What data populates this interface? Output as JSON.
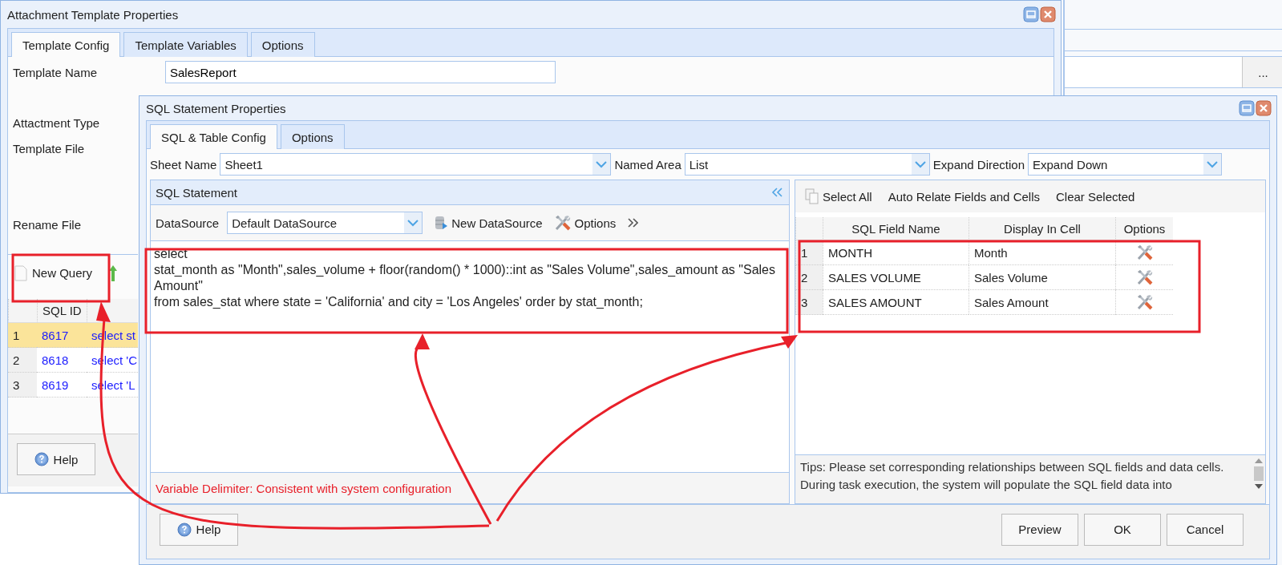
{
  "back_window": {
    "title": "Attachment Template Properties",
    "tabs": [
      {
        "label": "Template Config",
        "selected": true
      },
      {
        "label": "Template Variables",
        "selected": false
      },
      {
        "label": "Options",
        "selected": false
      }
    ],
    "template_name": {
      "label": "Template Name",
      "value": "SalesReport"
    },
    "labels": [
      "Attactment Type",
      "Template File",
      "Rename File"
    ],
    "new_query": "New Query",
    "table": {
      "columns": [
        "SQL ID"
      ],
      "rows": [
        {
          "index": "1",
          "sql_id": "8617",
          "sql": "select st",
          "selected": true
        },
        {
          "index": "2",
          "sql_id": "8618",
          "sql": "select 'C",
          "selected": false
        },
        {
          "index": "3",
          "sql_id": "8619",
          "sql": "select 'L",
          "selected": false
        }
      ]
    },
    "help": "Help"
  },
  "side_window": {
    "button": "..."
  },
  "sql_dialog": {
    "title": "SQL Statement Properties",
    "tabs": [
      {
        "label": "SQL & Table Config",
        "selected": true
      },
      {
        "label": "Options",
        "selected": false
      }
    ],
    "selects": [
      {
        "label": "Sheet Name",
        "value": "Sheet1"
      },
      {
        "label": "Named Area",
        "value": "List"
      },
      {
        "label": "Expand Direction",
        "value": "Expand Down"
      }
    ],
    "sql_panel": {
      "title": "SQL Statement",
      "datasource_label": "DataSource",
      "datasource_value": "Default DataSource",
      "new_datasource": "New DataSource",
      "options": "Options",
      "sql_lines": [
        "select",
        "stat_month as \"Month\",sales_volume + floor(random() * 1000)::int as \"Sales Volume\",sales_amount as \"Sales Amount\"",
        "from sales_stat where state = 'California' and city = 'Los Angeles' order by stat_month;"
      ],
      "delimiter_note": "Variable Delimiter: Consistent with system configuration"
    },
    "mapping": {
      "toolbar": [
        {
          "label": "Select All",
          "kind": "icon"
        },
        {
          "label": "Auto Relate Fields and Cells",
          "kind": "plain"
        },
        {
          "label": "Clear Selected",
          "kind": "plain"
        }
      ],
      "columns": [
        "SQL Field Name",
        "Display In Cell",
        "Options"
      ],
      "rows": [
        {
          "index": "1",
          "field": "MONTH",
          "cell": "Month"
        },
        {
          "index": "2",
          "field": "SALES VOLUME",
          "cell": "Sales Volume"
        },
        {
          "index": "3",
          "field": "SALES AMOUNT",
          "cell": "Sales Amount"
        }
      ],
      "tips": "Tips: Please set corresponding relationships between SQL fields and data cells. During task execution, the system will populate the SQL field data into"
    },
    "buttons": {
      "help": "Help",
      "preview": "Preview",
      "ok": "OK",
      "cancel": "Cancel"
    }
  }
}
